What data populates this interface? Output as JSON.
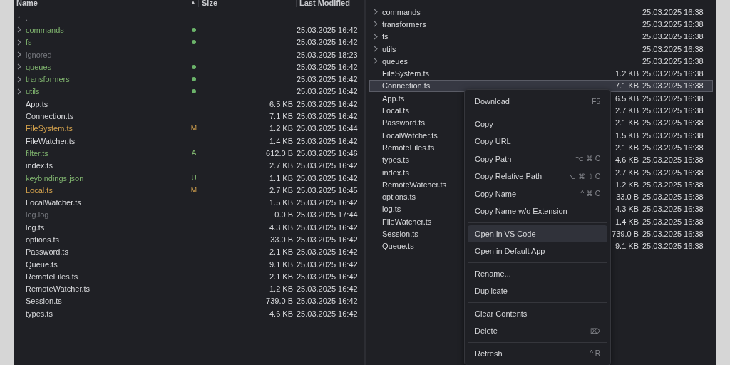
{
  "left_pane": {
    "columns": [
      {
        "label": "Name",
        "sort_icon": "▲"
      },
      {
        "label": "Size"
      },
      {
        "label": "Last Modified"
      }
    ],
    "parent_row": {
      "icon": "↑",
      "label": ".."
    },
    "rows": [
      {
        "kind": "folder",
        "name": "commands",
        "color": "#7fb36e",
        "status_dot": true,
        "modified": "25.03.2025 16:42"
      },
      {
        "kind": "folder",
        "name": "fs",
        "color": "#7fb36e",
        "status_dot": true,
        "modified": "25.03.2025 16:42"
      },
      {
        "kind": "folder",
        "name": "ignored",
        "color": "#77797f",
        "modified": "25.03.2025 18:23"
      },
      {
        "kind": "folder",
        "name": "queues",
        "color": "#7fb36e",
        "status_dot": true,
        "modified": "25.03.2025 16:42"
      },
      {
        "kind": "folder",
        "name": "transformers",
        "color": "#7fb36e",
        "status_dot": true,
        "modified": "25.03.2025 16:42"
      },
      {
        "kind": "folder",
        "name": "utils",
        "color": "#7fb36e",
        "status_dot": true,
        "modified": "25.03.2025 16:42"
      },
      {
        "kind": "file",
        "name": "App.ts",
        "color": "#d8d9dc",
        "size": "6.5 KB",
        "modified": "25.03.2025 16:42"
      },
      {
        "kind": "file",
        "name": "Connection.ts",
        "color": "#d8d9dc",
        "size": "7.1 KB",
        "modified": "25.03.2025 16:42"
      },
      {
        "kind": "file",
        "name": "FileSystem.ts",
        "color": "#d3a14d",
        "badge": "M",
        "size": "1.2 KB",
        "modified": "25.03.2025 16:44"
      },
      {
        "kind": "file",
        "name": "FileWatcher.ts",
        "color": "#d8d9dc",
        "size": "1.4 KB",
        "modified": "25.03.2025 16:42"
      },
      {
        "kind": "file",
        "name": "filter.ts",
        "color": "#7fb36e",
        "badge": "A",
        "size": "612.0 B",
        "modified": "25.03.2025 16:46"
      },
      {
        "kind": "file",
        "name": "index.ts",
        "color": "#d8d9dc",
        "size": "2.7 KB",
        "modified": "25.03.2025 16:42"
      },
      {
        "kind": "file",
        "name": "keybindings.json",
        "color": "#7fb36e",
        "badge": "U",
        "size": "1.1 KB",
        "modified": "25.03.2025 16:42"
      },
      {
        "kind": "file",
        "name": "Local.ts",
        "color": "#d3a14d",
        "badge": "M",
        "size": "2.7 KB",
        "modified": "25.03.2025 16:45"
      },
      {
        "kind": "file",
        "name": "LocalWatcher.ts",
        "color": "#d8d9dc",
        "size": "1.5 KB",
        "modified": "25.03.2025 16:42"
      },
      {
        "kind": "file",
        "name": "log.log",
        "color": "#77797f",
        "size": "0.0 B",
        "modified": "25.03.2025 17:44"
      },
      {
        "kind": "file",
        "name": "log.ts",
        "color": "#d8d9dc",
        "size": "4.3 KB",
        "modified": "25.03.2025 16:42"
      },
      {
        "kind": "file",
        "name": "options.ts",
        "color": "#d8d9dc",
        "size": "33.0 B",
        "modified": "25.03.2025 16:42"
      },
      {
        "kind": "file",
        "name": "Password.ts",
        "color": "#d8d9dc",
        "size": "2.1 KB",
        "modified": "25.03.2025 16:42"
      },
      {
        "kind": "file",
        "name": "Queue.ts",
        "color": "#d8d9dc",
        "size": "9.1 KB",
        "modified": "25.03.2025 16:42"
      },
      {
        "kind": "file",
        "name": "RemoteFiles.ts",
        "color": "#d8d9dc",
        "size": "2.1 KB",
        "modified": "25.03.2025 16:42"
      },
      {
        "kind": "file",
        "name": "RemoteWatcher.ts",
        "color": "#d8d9dc",
        "size": "1.2 KB",
        "modified": "25.03.2025 16:42"
      },
      {
        "kind": "file",
        "name": "Session.ts",
        "color": "#d8d9dc",
        "size": "739.0 B",
        "modified": "25.03.2025 16:42"
      },
      {
        "kind": "file",
        "name": "types.ts",
        "color": "#d8d9dc",
        "size": "4.6 KB",
        "modified": "25.03.2025 16:42"
      }
    ]
  },
  "right_pane": {
    "rows": [
      {
        "kind": "folder",
        "name": "commands",
        "modified": "25.03.2025 16:38",
        "selected": false
      },
      {
        "kind": "folder",
        "name": "transformers",
        "modified": "25.03.2025 16:38",
        "selected": false
      },
      {
        "kind": "folder",
        "name": "fs",
        "modified": "25.03.2025 16:38",
        "selected": false
      },
      {
        "kind": "folder",
        "name": "utils",
        "modified": "25.03.2025 16:38",
        "selected": false
      },
      {
        "kind": "folder",
        "name": "queues",
        "modified": "25.03.2025 16:38",
        "selected": false
      },
      {
        "kind": "file",
        "name": "FileSystem.ts",
        "size": "1.2 KB",
        "modified": "25.03.2025 16:38",
        "selected": false
      },
      {
        "kind": "file",
        "name": "Connection.ts",
        "size": "7.1 KB",
        "modified": "25.03.2025 16:38",
        "selected": true
      },
      {
        "kind": "file",
        "name": "App.ts",
        "size": "6.5 KB",
        "modified": "25.03.2025 16:38",
        "selected": false
      },
      {
        "kind": "file",
        "name": "Local.ts",
        "size": "2.7 KB",
        "modified": "25.03.2025 16:38",
        "selected": false
      },
      {
        "kind": "file",
        "name": "Password.ts",
        "size": "2.1 KB",
        "modified": "25.03.2025 16:38",
        "selected": false
      },
      {
        "kind": "file",
        "name": "LocalWatcher.ts",
        "size": "1.5 KB",
        "modified": "25.03.2025 16:38",
        "selected": false
      },
      {
        "kind": "file",
        "name": "RemoteFiles.ts",
        "size": "2.1 KB",
        "modified": "25.03.2025 16:38",
        "selected": false
      },
      {
        "kind": "file",
        "name": "types.ts",
        "size": "4.6 KB",
        "modified": "25.03.2025 16:38",
        "selected": false
      },
      {
        "kind": "file",
        "name": "index.ts",
        "size": "2.7 KB",
        "modified": "25.03.2025 16:38",
        "selected": false
      },
      {
        "kind": "file",
        "name": "RemoteWatcher.ts",
        "size": "1.2 KB",
        "modified": "25.03.2025 16:38",
        "selected": false
      },
      {
        "kind": "file",
        "name": "options.ts",
        "size": "33.0 B",
        "modified": "25.03.2025 16:38",
        "selected": false
      },
      {
        "kind": "file",
        "name": "log.ts",
        "size": "4.3 KB",
        "modified": "25.03.2025 16:38",
        "selected": false
      },
      {
        "kind": "file",
        "name": "FileWatcher.ts",
        "size": "1.4 KB",
        "modified": "25.03.2025 16:38",
        "selected": false
      },
      {
        "kind": "file",
        "name": "Session.ts",
        "size": "739.0 B",
        "modified": "25.03.2025 16:38",
        "selected": false
      },
      {
        "kind": "file",
        "name": "Queue.ts",
        "size": "9.1 KB",
        "modified": "25.03.2025 16:38",
        "selected": false
      }
    ]
  },
  "context_menu": {
    "groups": [
      [
        {
          "label": "Download",
          "shortcut": "F5",
          "selected": false
        }
      ],
      [
        {
          "label": "Copy",
          "selected": false
        },
        {
          "label": "Copy URL",
          "selected": false
        },
        {
          "label": "Copy Path",
          "shortcut": "⌥ ⌘ C",
          "selected": false
        },
        {
          "label": "Copy Relative Path",
          "shortcut": "⌥ ⌘ ⇧ C",
          "selected": false
        },
        {
          "label": "Copy Name",
          "shortcut": "^ ⌘ C",
          "selected": false
        },
        {
          "label": "Copy Name w/o Extension",
          "selected": false
        }
      ],
      [
        {
          "label": "Open in VS Code",
          "selected": true
        },
        {
          "label": "Open in Default App",
          "selected": false
        }
      ],
      [
        {
          "label": "Rename...",
          "selected": false
        },
        {
          "label": "Duplicate",
          "selected": false
        }
      ],
      [
        {
          "label": "Clear Contents",
          "selected": false
        },
        {
          "label": "Delete",
          "shortcut": "⌦",
          "selected": false
        }
      ],
      [
        {
          "label": "Refresh",
          "shortcut": "^ R",
          "selected": false
        }
      ]
    ]
  }
}
